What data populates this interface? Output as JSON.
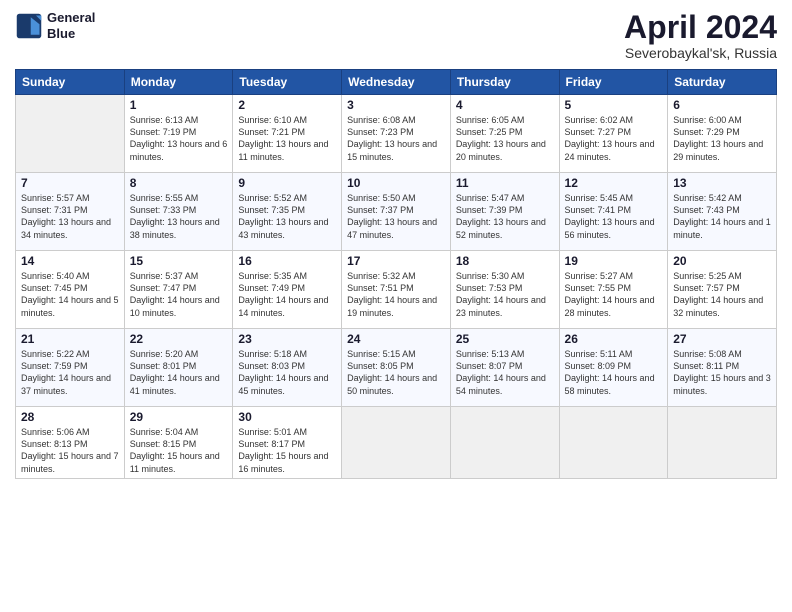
{
  "header": {
    "logo_line1": "General",
    "logo_line2": "Blue",
    "month": "April 2024",
    "location": "Severobaykal'sk, Russia"
  },
  "weekdays": [
    "Sunday",
    "Monday",
    "Tuesday",
    "Wednesday",
    "Thursday",
    "Friday",
    "Saturday"
  ],
  "weeks": [
    [
      {
        "num": "",
        "sunrise": "",
        "sunset": "",
        "daylight": "",
        "empty": true
      },
      {
        "num": "1",
        "sunrise": "6:13 AM",
        "sunset": "7:19 PM",
        "daylight": "13 hours and 6 minutes."
      },
      {
        "num": "2",
        "sunrise": "6:10 AM",
        "sunset": "7:21 PM",
        "daylight": "13 hours and 11 minutes."
      },
      {
        "num": "3",
        "sunrise": "6:08 AM",
        "sunset": "7:23 PM",
        "daylight": "13 hours and 15 minutes."
      },
      {
        "num": "4",
        "sunrise": "6:05 AM",
        "sunset": "7:25 PM",
        "daylight": "13 hours and 20 minutes."
      },
      {
        "num": "5",
        "sunrise": "6:02 AM",
        "sunset": "7:27 PM",
        "daylight": "13 hours and 24 minutes."
      },
      {
        "num": "6",
        "sunrise": "6:00 AM",
        "sunset": "7:29 PM",
        "daylight": "13 hours and 29 minutes."
      }
    ],
    [
      {
        "num": "7",
        "sunrise": "5:57 AM",
        "sunset": "7:31 PM",
        "daylight": "13 hours and 34 minutes."
      },
      {
        "num": "8",
        "sunrise": "5:55 AM",
        "sunset": "7:33 PM",
        "daylight": "13 hours and 38 minutes."
      },
      {
        "num": "9",
        "sunrise": "5:52 AM",
        "sunset": "7:35 PM",
        "daylight": "13 hours and 43 minutes."
      },
      {
        "num": "10",
        "sunrise": "5:50 AM",
        "sunset": "7:37 PM",
        "daylight": "13 hours and 47 minutes."
      },
      {
        "num": "11",
        "sunrise": "5:47 AM",
        "sunset": "7:39 PM",
        "daylight": "13 hours and 52 minutes."
      },
      {
        "num": "12",
        "sunrise": "5:45 AM",
        "sunset": "7:41 PM",
        "daylight": "13 hours and 56 minutes."
      },
      {
        "num": "13",
        "sunrise": "5:42 AM",
        "sunset": "7:43 PM",
        "daylight": "14 hours and 1 minute."
      }
    ],
    [
      {
        "num": "14",
        "sunrise": "5:40 AM",
        "sunset": "7:45 PM",
        "daylight": "14 hours and 5 minutes."
      },
      {
        "num": "15",
        "sunrise": "5:37 AM",
        "sunset": "7:47 PM",
        "daylight": "14 hours and 10 minutes."
      },
      {
        "num": "16",
        "sunrise": "5:35 AM",
        "sunset": "7:49 PM",
        "daylight": "14 hours and 14 minutes."
      },
      {
        "num": "17",
        "sunrise": "5:32 AM",
        "sunset": "7:51 PM",
        "daylight": "14 hours and 19 minutes."
      },
      {
        "num": "18",
        "sunrise": "5:30 AM",
        "sunset": "7:53 PM",
        "daylight": "14 hours and 23 minutes."
      },
      {
        "num": "19",
        "sunrise": "5:27 AM",
        "sunset": "7:55 PM",
        "daylight": "14 hours and 28 minutes."
      },
      {
        "num": "20",
        "sunrise": "5:25 AM",
        "sunset": "7:57 PM",
        "daylight": "14 hours and 32 minutes."
      }
    ],
    [
      {
        "num": "21",
        "sunrise": "5:22 AM",
        "sunset": "7:59 PM",
        "daylight": "14 hours and 37 minutes."
      },
      {
        "num": "22",
        "sunrise": "5:20 AM",
        "sunset": "8:01 PM",
        "daylight": "14 hours and 41 minutes."
      },
      {
        "num": "23",
        "sunrise": "5:18 AM",
        "sunset": "8:03 PM",
        "daylight": "14 hours and 45 minutes."
      },
      {
        "num": "24",
        "sunrise": "5:15 AM",
        "sunset": "8:05 PM",
        "daylight": "14 hours and 50 minutes."
      },
      {
        "num": "25",
        "sunrise": "5:13 AM",
        "sunset": "8:07 PM",
        "daylight": "14 hours and 54 minutes."
      },
      {
        "num": "26",
        "sunrise": "5:11 AM",
        "sunset": "8:09 PM",
        "daylight": "14 hours and 58 minutes."
      },
      {
        "num": "27",
        "sunrise": "5:08 AM",
        "sunset": "8:11 PM",
        "daylight": "15 hours and 3 minutes."
      }
    ],
    [
      {
        "num": "28",
        "sunrise": "5:06 AM",
        "sunset": "8:13 PM",
        "daylight": "15 hours and 7 minutes."
      },
      {
        "num": "29",
        "sunrise": "5:04 AM",
        "sunset": "8:15 PM",
        "daylight": "15 hours and 11 minutes."
      },
      {
        "num": "30",
        "sunrise": "5:01 AM",
        "sunset": "8:17 PM",
        "daylight": "15 hours and 16 minutes."
      },
      {
        "num": "",
        "sunrise": "",
        "sunset": "",
        "daylight": "",
        "empty": true
      },
      {
        "num": "",
        "sunrise": "",
        "sunset": "",
        "daylight": "",
        "empty": true
      },
      {
        "num": "",
        "sunrise": "",
        "sunset": "",
        "daylight": "",
        "empty": true
      },
      {
        "num": "",
        "sunrise": "",
        "sunset": "",
        "daylight": "",
        "empty": true
      }
    ]
  ]
}
